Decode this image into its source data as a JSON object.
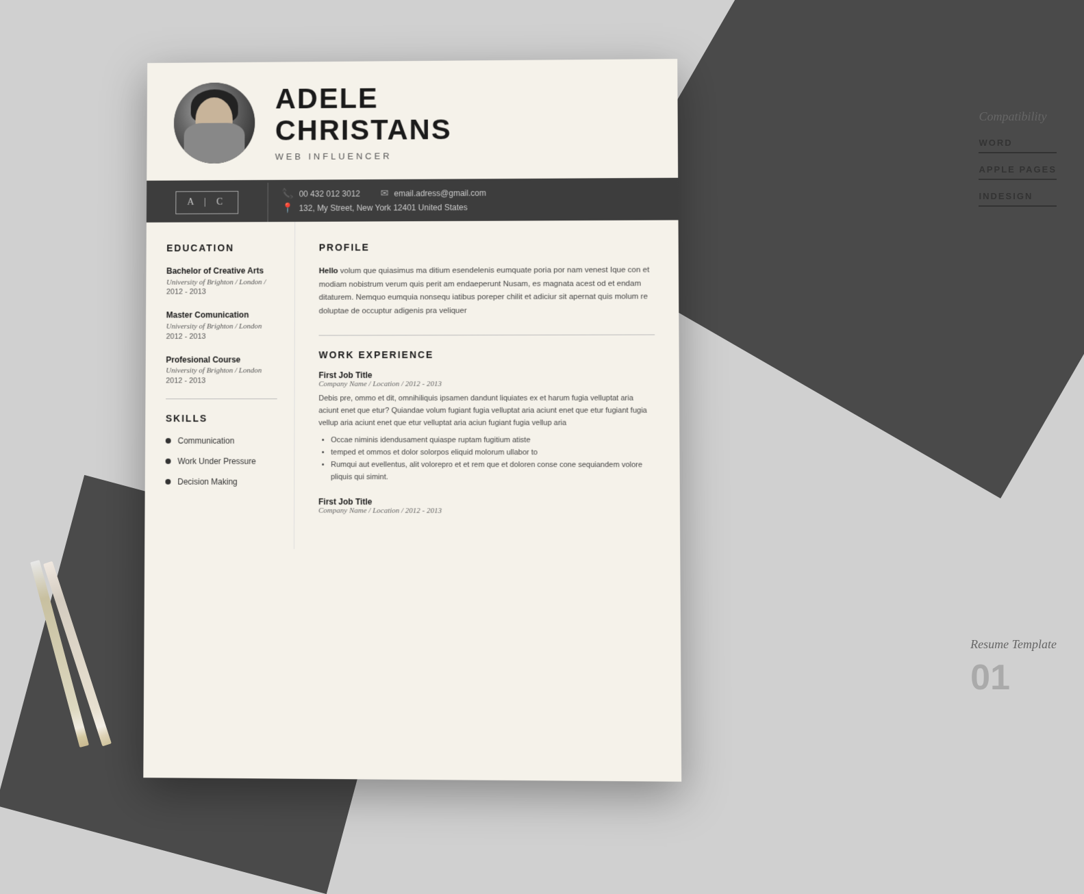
{
  "background": {
    "color": "#d0d0d0"
  },
  "resume": {
    "name_line1": "ADELE",
    "name_line2": "CHRISTANS",
    "title": "WEB INFLUENCER",
    "monogram": "A | C",
    "contact": {
      "phone": "00 432 012 3012",
      "email": "email.adress@gmail.com",
      "address": "132, My Street, New York 12401 United States"
    },
    "education": {
      "section_title": "EDUCATION",
      "items": [
        {
          "degree": "Bachelor of Creative Arts",
          "school": "University of Brighton / London /",
          "year": "2012 - 2013"
        },
        {
          "degree": "Master Comunication",
          "school": "University of Brighton / London",
          "year": "2012 - 2013"
        },
        {
          "degree": "Profesional Course",
          "school": "University of Brighton / London",
          "year": "2012 - 2013"
        }
      ]
    },
    "skills": {
      "section_title": "SKILLS",
      "items": [
        "Communication",
        "Work Under Pressure",
        "Decision Making"
      ]
    },
    "profile": {
      "section_title": "PROFILE",
      "intro_bold": "Hello",
      "text": " volum que quiasimus ma ditium esendelenis eumquate poria por nam venest Ique con et modiam nobistrum verum quis perit am endaeperunt Nusam, es magnata acest od et endam ditaturem. Nemquo eumquia nonsequ iatibus poreper chilit et adiciur sit apernat quis molum re doluptae de occuptur adigenis pra veliquer"
    },
    "work_experience": {
      "section_title": "WORK EXPERIENCE",
      "jobs": [
        {
          "title": "First Job Title",
          "company": "Company Name / Location / 2012 - 2013",
          "description": "Debis pre, ommo et dit, omnihiliquis ipsamen dandunt liquiates ex et harum fugia velluptat aria aciunt enet que etur? Quiandae volum fugiant fugia velluptat aria aciunt enet que etur fugiant fugia vellup aria aciunt enet que etur velluptat aria aciun fugiant fugia vellup aria",
          "bullets": [
            "Occae niminis idendusament quiaspe ruptam fugitium atiste",
            "temped et ommos et dolor solorpos eliquid molorum ullabor to",
            "Rumqui aut evellentus, alit volorepro et et rem que et doloren conse cone sequiandem volore pliquis qui simint."
          ]
        },
        {
          "title": "First Job Title",
          "company": "Company Name / Location / 2012 - 2013",
          "description": "",
          "bullets": []
        }
      ]
    }
  },
  "sidebar": {
    "compatibility_label": "Compatibility",
    "items": [
      "WORD",
      "APPLE PAGES",
      "INDESIGN"
    ],
    "template_label": "Resume Template",
    "template_number": "01"
  }
}
